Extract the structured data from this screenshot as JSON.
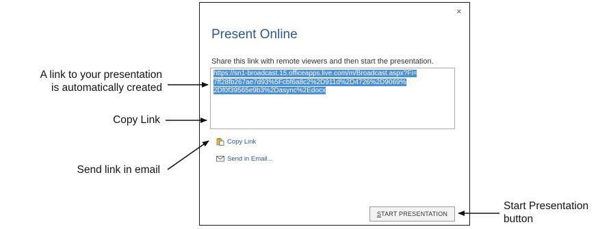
{
  "dialog": {
    "close_glyph": "×",
    "title": "Present Online",
    "instruction": "Share this link with remote viewers and then start the presentation.",
    "link_lines": [
      "https://sn1-broadcast.15.officeapps.live.com/m/Broadcast.aspx?Fi=",
      "7ff28fb267ae7d93%5Fcbf6a8c2%2D911d%2D4726%2D9069%",
      "2Df0f39565e9b3%2Dasync%2Edocx"
    ],
    "copy_link_label": "Copy Link",
    "send_email_label": "Send in Email...",
    "start_button_first": "S",
    "start_button_rest": "TART PRESENTATION"
  },
  "callouts": {
    "link_line1": "A link to your presentation",
    "link_line2": "is automatically created",
    "copy": "Copy Link",
    "email": "Send link in email",
    "start_line1": "Start Presentation",
    "start_line2": "button"
  },
  "icons": {
    "copy": "clipboard-icon",
    "email": "envelope-icon",
    "close": "close-icon"
  },
  "colors": {
    "title": "#2b5797",
    "selection": "#4a8fdb",
    "link_action": "#2b5797"
  }
}
